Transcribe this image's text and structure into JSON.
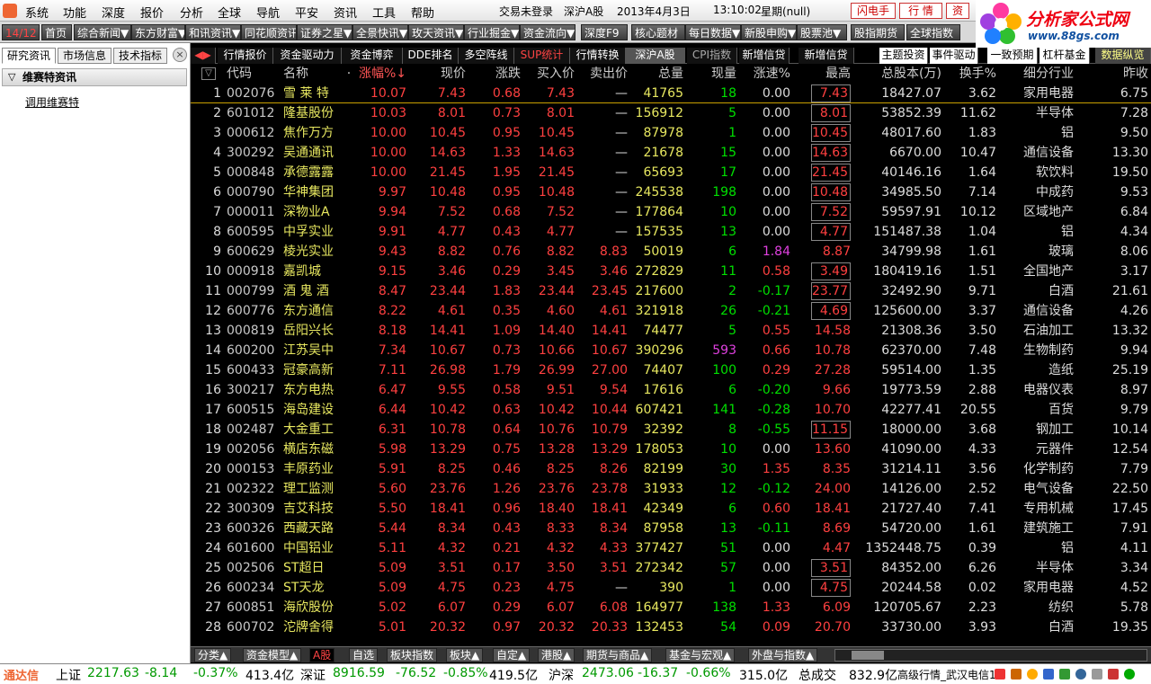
{
  "menu": {
    "items": [
      "系统",
      "功能",
      "深度",
      "报价",
      "分析",
      "全球",
      "导航",
      "平安",
      "资讯",
      "工具",
      "帮助"
    ],
    "login_status": "交易未登录",
    "market": "深沪A股",
    "date": "2013年4月3日",
    "time": "13:10:02",
    "weekday": "星期(null)",
    "flash_label": "闪电手",
    "quote_label": "行 情",
    "zi_label": "资"
  },
  "brand": {
    "title": "分析家公式网",
    "url": "www.88gs.com"
  },
  "navbar": {
    "page_indicator": "14/12",
    "items": [
      "首页",
      "综合新闻▼",
      "东方财富▼",
      "和讯资讯▼",
      "同花顺资讯▼",
      "证券之星▼",
      "全景快讯▼",
      "玫天资讯▼",
      "行业掘金▼",
      "资金流向▼",
      "深度F9",
      "核心题材",
      "每日数据▼",
      "新股申购▼",
      "股票池▼",
      "股指期货",
      "全球指数"
    ]
  },
  "left_panel": {
    "tabs": [
      "研究资讯",
      "市场信息",
      "技术指标"
    ],
    "section_title": "维赛特资讯",
    "link_text": "调用维赛特"
  },
  "top_tabs": {
    "items": [
      "行情报价",
      "资金驱动力",
      "资金博弈",
      "DDE排名",
      "多空阵线",
      "SUP统计",
      "行情转换",
      "深沪A股",
      "CPI指数",
      "新增信贷",
      "新增信贷"
    ],
    "right_items": [
      "主题投资",
      "事件驱动",
      "一致预期",
      "杠杆基金",
      "数据纵览"
    ]
  },
  "table": {
    "headers": [
      "代码",
      "名称",
      "·",
      "涨幅%↓",
      "现价",
      "涨跌",
      "买入价",
      "卖出价",
      "总量",
      "现量",
      "涨速%",
      "最高",
      "总股本(万)",
      "换手%",
      "细分行业",
      "昨收"
    ],
    "rows": [
      [
        "1",
        "002076",
        "雪 莱 特",
        "10.07",
        "7.43",
        "0.68",
        "7.43",
        "—",
        "41765",
        "18",
        "0.00",
        "7.43",
        "18427.07",
        "3.62",
        "家用电器",
        "6.75"
      ],
      [
        "2",
        "601012",
        "隆基股份",
        "10.03",
        "8.01",
        "0.73",
        "8.01",
        "—",
        "156912",
        "5",
        "0.00",
        "8.01",
        "53852.39",
        "11.62",
        "半导体",
        "7.28"
      ],
      [
        "3",
        "000612",
        "焦作万方",
        "10.00",
        "10.45",
        "0.95",
        "10.45",
        "—",
        "87978",
        "1",
        "0.00",
        "10.45",
        "48017.60",
        "1.83",
        "铝",
        "9.50"
      ],
      [
        "4",
        "300292",
        "吴通通讯",
        "10.00",
        "14.63",
        "1.33",
        "14.63",
        "—",
        "21678",
        "15",
        "0.00",
        "14.63",
        "6670.00",
        "10.47",
        "通信设备",
        "13.30"
      ],
      [
        "5",
        "000848",
        "承德露露",
        "10.00",
        "21.45",
        "1.95",
        "21.45",
        "—",
        "65693",
        "17",
        "0.00",
        "21.45",
        "40146.16",
        "1.64",
        "软饮料",
        "19.50"
      ],
      [
        "6",
        "000790",
        "华神集团",
        "9.97",
        "10.48",
        "0.95",
        "10.48",
        "—",
        "245538",
        "198",
        "0.00",
        "10.48",
        "34985.50",
        "7.14",
        "中成药",
        "9.53"
      ],
      [
        "7",
        "000011",
        "深物业A",
        "9.94",
        "7.52",
        "0.68",
        "7.52",
        "—",
        "177864",
        "10",
        "0.00",
        "7.52",
        "59597.91",
        "10.12",
        "区域地产",
        "6.84"
      ],
      [
        "8",
        "600595",
        "中孚实业",
        "9.91",
        "4.77",
        "0.43",
        "4.77",
        "—",
        "157535",
        "13",
        "0.00",
        "4.77",
        "151487.38",
        "1.04",
        "铝",
        "4.34"
      ],
      [
        "9",
        "600629",
        "棱光实业",
        "9.43",
        "8.82",
        "0.76",
        "8.82",
        "8.83",
        "50019",
        "6",
        "1.84",
        "8.87",
        "34799.98",
        "1.61",
        "玻璃",
        "8.06"
      ],
      [
        "10",
        "000918",
        "嘉凯城",
        "9.15",
        "3.46",
        "0.29",
        "3.45",
        "3.46",
        "272829",
        "11",
        "0.58",
        "3.49",
        "180419.16",
        "1.51",
        "全国地产",
        "3.17"
      ],
      [
        "11",
        "000799",
        "酒 鬼 酒",
        "8.47",
        "23.44",
        "1.83",
        "23.44",
        "23.45",
        "217600",
        "2",
        "-0.17",
        "23.77",
        "32492.90",
        "9.71",
        "白酒",
        "21.61"
      ],
      [
        "12",
        "600776",
        "东方通信",
        "8.22",
        "4.61",
        "0.35",
        "4.60",
        "4.61",
        "321918",
        "26",
        "-0.21",
        "4.69",
        "125600.00",
        "3.37",
        "通信设备",
        "4.26"
      ],
      [
        "13",
        "000819",
        "岳阳兴长",
        "8.18",
        "14.41",
        "1.09",
        "14.40",
        "14.41",
        "74477",
        "5",
        "0.55",
        "14.58",
        "21308.36",
        "3.50",
        "石油加工",
        "13.32"
      ],
      [
        "14",
        "600200",
        "江苏吴中",
        "7.34",
        "10.67",
        "0.73",
        "10.66",
        "10.67",
        "390296",
        "593",
        "0.66",
        "10.78",
        "62370.00",
        "7.48",
        "生物制药",
        "9.94"
      ],
      [
        "15",
        "600433",
        "冠豪高新",
        "7.11",
        "26.98",
        "1.79",
        "26.99",
        "27.00",
        "74407",
        "100",
        "0.29",
        "27.28",
        "59514.00",
        "1.35",
        "造纸",
        "25.19"
      ],
      [
        "16",
        "300217",
        "东方电热",
        "6.47",
        "9.55",
        "0.58",
        "9.51",
        "9.54",
        "17616",
        "6",
        "-0.20",
        "9.66",
        "19773.59",
        "2.88",
        "电器仪表",
        "8.97"
      ],
      [
        "17",
        "600515",
        "海岛建设",
        "6.44",
        "10.42",
        "0.63",
        "10.42",
        "10.44",
        "607421",
        "141",
        "-0.28",
        "10.70",
        "42277.41",
        "20.55",
        "百货",
        "9.79"
      ],
      [
        "18",
        "002487",
        "大金重工",
        "6.31",
        "10.78",
        "0.64",
        "10.76",
        "10.79",
        "32392",
        "8",
        "-0.55",
        "11.15",
        "18000.00",
        "3.68",
        "钢加工",
        "10.14"
      ],
      [
        "19",
        "002056",
        "横店东磁",
        "5.98",
        "13.29",
        "0.75",
        "13.28",
        "13.29",
        "178053",
        "10",
        "0.00",
        "13.60",
        "41090.00",
        "4.33",
        "元器件",
        "12.54"
      ],
      [
        "20",
        "000153",
        "丰原药业",
        "5.91",
        "8.25",
        "0.46",
        "8.25",
        "8.26",
        "82199",
        "30",
        "1.35",
        "8.35",
        "31214.11",
        "3.56",
        "化学制药",
        "7.79"
      ],
      [
        "21",
        "002322",
        "理工监测",
        "5.60",
        "23.76",
        "1.26",
        "23.76",
        "23.78",
        "31933",
        "12",
        "-0.12",
        "24.00",
        "14126.00",
        "2.52",
        "电气设备",
        "22.50"
      ],
      [
        "22",
        "300309",
        "吉艾科技",
        "5.50",
        "18.41",
        "0.96",
        "18.40",
        "18.41",
        "42349",
        "6",
        "0.60",
        "18.41",
        "21727.40",
        "7.41",
        "专用机械",
        "17.45"
      ],
      [
        "23",
        "600326",
        "西藏天路",
        "5.44",
        "8.34",
        "0.43",
        "8.33",
        "8.34",
        "87958",
        "13",
        "-0.11",
        "8.69",
        "54720.00",
        "1.61",
        "建筑施工",
        "7.91"
      ],
      [
        "24",
        "601600",
        "中国铝业",
        "5.11",
        "4.32",
        "0.21",
        "4.32",
        "4.33",
        "377427",
        "51",
        "0.00",
        "4.47",
        "1352448.75",
        "0.39",
        "铝",
        "4.11"
      ],
      [
        "25",
        "002506",
        "ST超日",
        "5.09",
        "3.51",
        "0.17",
        "3.50",
        "3.51",
        "272342",
        "57",
        "0.00",
        "3.51",
        "84352.00",
        "6.26",
        "半导体",
        "3.34"
      ],
      [
        "26",
        "600234",
        "ST天龙",
        "5.09",
        "4.75",
        "0.23",
        "4.75",
        "—",
        "390",
        "1",
        "0.00",
        "4.75",
        "20244.58",
        "0.02",
        "家用电器",
        "4.52"
      ],
      [
        "27",
        "600851",
        "海欣股份",
        "5.02",
        "6.07",
        "0.29",
        "6.07",
        "6.08",
        "164977",
        "138",
        "1.33",
        "6.09",
        "120705.67",
        "2.23",
        "纺织",
        "5.78"
      ],
      [
        "28",
        "600702",
        "沱牌舍得",
        "5.01",
        "20.32",
        "0.97",
        "20.32",
        "20.33",
        "132453",
        "54",
        "0.09",
        "20.70",
        "33730.00",
        "3.93",
        "白酒",
        "19.35"
      ]
    ]
  },
  "bottom_tabs": [
    "分类▲",
    "资金模型▲",
    "A股",
    "自选",
    "板块指数",
    "板块▲",
    "自定▲",
    "港股▲",
    "期货与商品▲",
    "基金与宏观▲",
    "外盘与指数▲"
  ],
  "ticker": {
    "brand": "通达信",
    "sh_label": "上证",
    "sh_val": "2217.63",
    "sh_chg": "-8.14",
    "sh_pct": "-0.37%",
    "sh_amt": "413.4亿",
    "sz_label": "深证",
    "sz_val": "8916.59",
    "sz_chg": "-76.52",
    "sz_pct": "-0.85%",
    "sz_amt": "419.5亿",
    "hs_label": "沪深",
    "hs_val": "2473.06",
    "hs_chg": "-16.37",
    "hs_pct": "-0.66%",
    "hs_amt": "315.0亿",
    "total_label": "总成交",
    "total_val": "832.9亿",
    "status": "高级行情_武汉电信1"
  },
  "colors": {
    "up": "#ff4040",
    "down": "#00e000",
    "name": "#e8e860",
    "vol": "#e8e860",
    "code": "#c8c8c8"
  }
}
